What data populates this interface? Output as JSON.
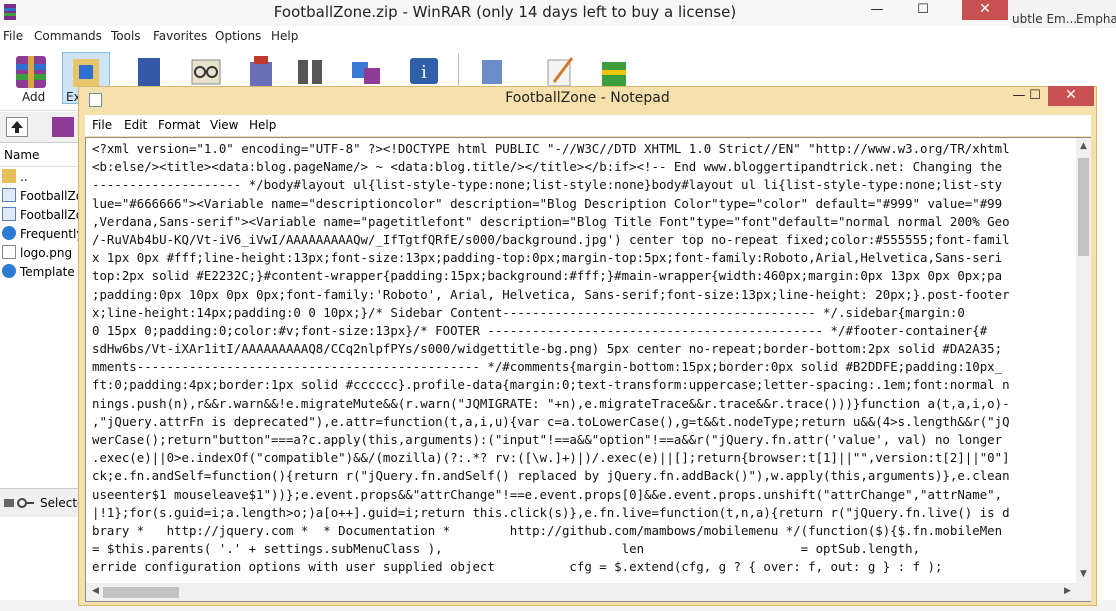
{
  "winrar": {
    "title": "FootballZone.zip - WinRAR (only 14 days left to buy a license)",
    "controls": {
      "minimize": "—",
      "maximize": "☐",
      "close": "✕"
    },
    "menu": [
      "File",
      "Commands",
      "Tools",
      "Favorites",
      "Options",
      "Help"
    ],
    "toolbar": {
      "add_label": "Add",
      "extract_label": "Ex"
    },
    "list_header": "Name",
    "files": [
      {
        "name": "..",
        "icon": "folder-icon"
      },
      {
        "name": "FootballZo",
        "icon": "file-icon"
      },
      {
        "name": "FootballZo",
        "icon": "file-icon"
      },
      {
        "name": "Frequently",
        "icon": "globe-icon"
      },
      {
        "name": "logo.png",
        "icon": "image-icon"
      },
      {
        "name": "Template s",
        "icon": "globe-icon"
      }
    ],
    "status_text": "Selecte"
  },
  "word": {
    "styles": [
      "ubtle Em...",
      "Empha"
    ]
  },
  "notepad": {
    "title": "FootballZone - Notepad",
    "controls": {
      "minimize": "—",
      "maximize": "☐",
      "close": "✕"
    },
    "menu": [
      "File",
      "Edit",
      "Format",
      "View",
      "Help"
    ],
    "lines": [
      "<?xml version=\"1.0\" encoding=\"UTF-8\" ?><!DOCTYPE html PUBLIC \"-//W3C//DTD XHTML 1.0 Strict//EN\" \"http://www.w3.org/TR/xhtml",
      "<b:else/><title><data:blog.pageName/> ~ <data:blog.title/></title></b:if><!-- End www.bloggertipandtrick.net: Changing the",
      "-------------------- */body#layout ul{list-style-type:none;list-style:none}body#layout ul li{list-style-type:none;list-sty",
      "lue=\"#666666\"><Variable name=\"descriptioncolor\" description=\"Blog Description Color\"type=\"color\" default=\"#999\" value=\"#99",
      ",Verdana,Sans-serif\"><Variable name=\"pagetitlefont\" description=\"Blog Title Font\"type=\"font\"default=\"normal normal 200% Geo",
      "/-RuVAb4bU-KQ/Vt-iV6_iVwI/AAAAAAAAAQw/_IfTgtfQRfE/s000/background.jpg') center top no-repeat fixed;color:#555555;font-famil",
      "x 1px 0px #fff;line-height:13px;font-size:13px;padding-top:0px;margin-top:5px;font-family:Roboto,Arial,Helvetica,Sans-seri",
      "top:2px solid #E2232C;}#content-wrapper{padding:15px;background:#fff;}#main-wrapper{width:460px;margin:0px 13px 0px 0px;pa",
      ";padding:0px 10px 0px 0px;font-family:'Roboto', Arial, Helvetica, Sans-serif;font-size:13px;line-height: 20px;}.post-footer",
      "x;line-height:14px;padding:0 0 10px;}/* Sidebar Content------------------------------------------ */.sidebar{margin:0",
      "0 15px 0;padding:0;color:#v;font-size:13px}/* FOOTER --------------------------------------------- */#footer-container{#",
      "sdHw6bs/Vt-iXAr1itI/AAAAAAAAAQ8/CCq2nlpfPYs/s000/widgettitle-bg.png) 5px center no-repeat;border-bottom:2px solid #DA2A35;",
      "mments---------------------------------------------- */#comments{margin-bottom:15px;border:0px solid #B2DDFE;padding:10px_",
      "ft:0;padding:4px;border:1px solid #cccccc}.profile-data{margin:0;text-transform:uppercase;letter-spacing:.1em;font:normal n",
      "nings.push(n),r&&r.warn&&!e.migrateMute&&(r.warn(\"JQMIGRATE: \"+n),e.migrateTrace&&r.trace&&r.trace()))}function a(t,a,i,o)-",
      ",\"jQuery.attrFn is deprecated\"),e.attr=function(t,a,i,u){var c=a.toLowerCase(),g=t&&t.nodeType;return u&&(4>s.length&&r(\"jQ",
      "werCase();return\"button\"===a?c.apply(this,arguments):(\"input\"!==a&&\"option\"!==a&&r(\"jQuery.fn.attr('value', val) no longer",
      ".exec(e)||0>e.indexOf(\"compatible\")&&/(mozilla)(?:.*? rv:([\\w.]+)|)/.exec(e)||[];return{browser:t[1]||\"\",version:t[2]||\"0\"]",
      "ck;e.fn.andSelf=function(){return r(\"jQuery.fn.andSelf() replaced by jQuery.fn.addBack()\"),w.apply(this,arguments)},e.clean",
      "useenter$1 mouseleave$1\"))};e.event.props&&\"attrChange\"!==e.event.props[0]&&e.event.props.unshift(\"attrChange\",\"attrName\",",
      "|!1};for(s.guid=i;a.length>o;)a[o++].guid=i;return this.click(s)},e.fn.live=function(t,n,a){return r(\"jQuery.fn.live() is d",
      "brary *   http://jquery.com *  * Documentation *        http://github.com/mambows/mobilemenu */(function($){$.fn.mobileMen",
      "= $this.parents( '.' + settings.subMenuClass ),                        len                     = optSub.length,",
      "erride configuration options with user supplied object          cfg = $.extend(cfg, g ? { over: f, out: g } : f );"
    ]
  }
}
